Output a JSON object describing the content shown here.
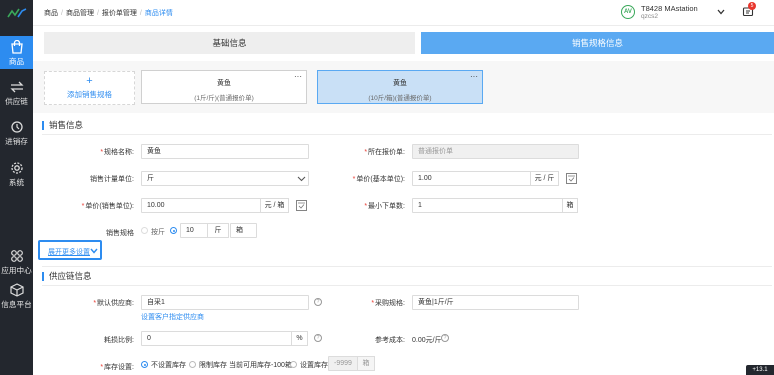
{
  "sidebar": {
    "items": [
      {
        "label": "商品",
        "icon": "shopping-bag-icon"
      },
      {
        "label": "供应链",
        "icon": "exchange-icon"
      },
      {
        "label": "进销存",
        "icon": "inventory-icon"
      },
      {
        "label": "系统",
        "icon": "gear-icon"
      },
      {
        "label": "应用中心",
        "icon": "app-center-icon"
      },
      {
        "label": "信息平台",
        "icon": "cube-icon"
      }
    ]
  },
  "header": {
    "breadcrumb": [
      "商品",
      "商品管理",
      "报价单管理",
      "商品详情"
    ],
    "store_badge": "AV",
    "store_name": "T8428 MAstation",
    "store_code": "qzcs2",
    "notification_count": "5"
  },
  "tabs": [
    {
      "label": "基础信息"
    },
    {
      "label": "销售规格信息"
    }
  ],
  "spec": {
    "add_label": "添加销售规格",
    "add_plus": "+",
    "cards": [
      {
        "name": "黄鱼",
        "sub": "(1斤/斤)(普通报价单)",
        "menu": "···"
      },
      {
        "name": "黄鱼",
        "sub": "(10斤/箱)(普通报价单)",
        "menu": "···"
      }
    ]
  },
  "sales_info": {
    "title": "销售信息",
    "spec_name_label": "规格名称:",
    "spec_name_value": "黄鱼",
    "quote_label": "所在报价单:",
    "quote_value": "普通报价单",
    "unit_label": "销售计量单位:",
    "unit_value": "斤",
    "price_base_label": "单价(基本单位):",
    "price_base_value": "1.00",
    "price_base_unit": "元 / 斤",
    "price_sale_label": "单价(销售单位):",
    "price_sale_value": "10.00",
    "price_sale_unit": "元 / 箱",
    "min_order_label": "最小下单数:",
    "min_order_value": "1",
    "min_order_unit": "箱",
    "spec_label": "销售规格",
    "spec_opt_jin": "按斤",
    "spec_qty": "10",
    "spec_qty_unit": "斤",
    "spec_pack_unit": "箱",
    "expand_label": "展开更多设置"
  },
  "supply_info": {
    "title": "供应链信息",
    "supplier_label": "默认供应商:",
    "supplier_value": "自采1",
    "supplier_link": "设置客户指定供应商",
    "purchase_spec_label": "采购规格:",
    "purchase_spec_value": "黄鱼|1斤/斤",
    "loss_label": "耗损比例:",
    "loss_value": "0",
    "loss_unit": "%",
    "ref_cost_label": "参考成本:",
    "ref_cost_value": "0.00元/斤",
    "stock_label": "库存设置:",
    "stock_opt1": "不设置库存",
    "stock_opt2": "限制库存 当前可用库存-100箱",
    "stock_opt3": "设置库存",
    "stock_placeholder": "-9999",
    "stock_unit": "箱"
  },
  "version": "+13.1"
}
